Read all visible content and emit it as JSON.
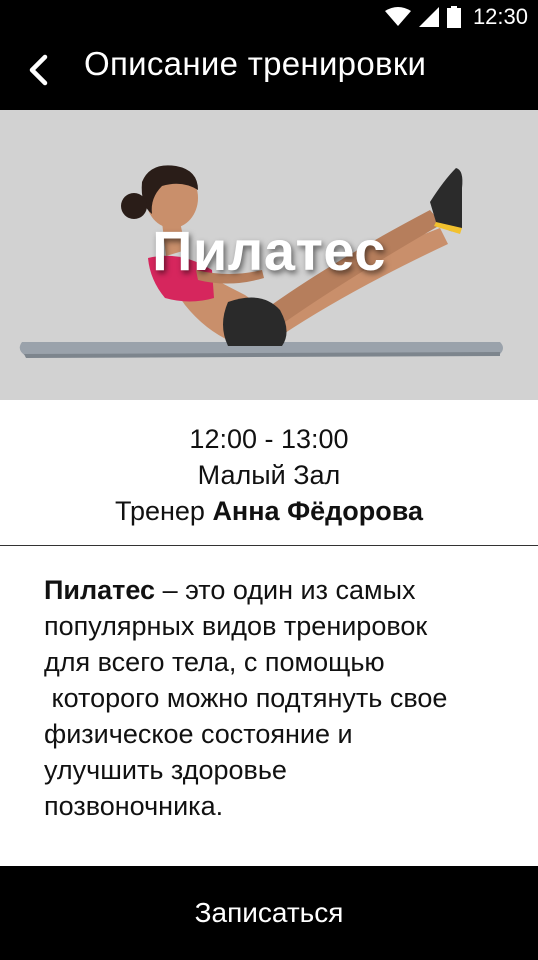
{
  "status_bar": {
    "time": "12:30",
    "icons": [
      "wifi-icon",
      "signal-icon",
      "battery-icon"
    ]
  },
  "app_bar": {
    "back_icon": "chevron-left-icon",
    "title": "Описание тренировки"
  },
  "hero": {
    "title": "Пилатес",
    "image": "woman-doing-pilates-v-sit-on-mat"
  },
  "session": {
    "time": "12:00 - 13:00",
    "room": "Малый Зал",
    "trainer_prefix": "Тренер ",
    "trainer_name": "Анна Фёдорова"
  },
  "description": {
    "bold_term": "Пилатес",
    "line1_rest": " – это один из самых",
    "line2": "популярных видов тренировок",
    "line3": "для всего тела, с помощью",
    "line4": " которого можно подтянуть свое",
    "line5": "физическое состояние и",
    "line6": "улучшить здоровье",
    "line7": "позвоночника."
  },
  "action": {
    "label": "Записаться"
  },
  "colors": {
    "bar_background": "#000000",
    "hero_background": "#d0d0d0",
    "text": "#111111",
    "top_accent": "#e0245e"
  }
}
